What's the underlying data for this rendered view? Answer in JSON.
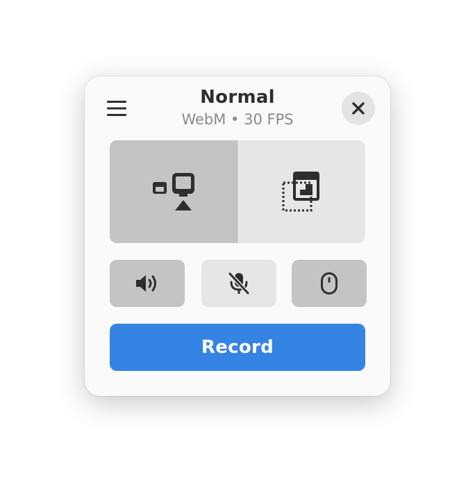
{
  "header": {
    "title": "Normal",
    "subtitle": "WebM • 30 FPS",
    "menu_icon": "hamburger-menu-icon",
    "close_icon": "close-icon"
  },
  "modes": [
    {
      "name": "screen",
      "icon": "screen-with-pointer-icon",
      "active": true
    },
    {
      "name": "selection",
      "icon": "selection-area-icon",
      "active": false
    }
  ],
  "toggles": [
    {
      "name": "desktop-audio",
      "icon": "speaker-icon",
      "on": true
    },
    {
      "name": "microphone",
      "icon": "microphone-muted-icon",
      "on": false
    },
    {
      "name": "pointer",
      "icon": "mouse-icon",
      "on": true
    }
  ],
  "record": {
    "label": "Record"
  },
  "colors": {
    "accent": "#3584e4",
    "active_toggle": "#c4c4c4",
    "inactive_toggle": "#e6e6e6",
    "icon": "#2e2e2e"
  }
}
